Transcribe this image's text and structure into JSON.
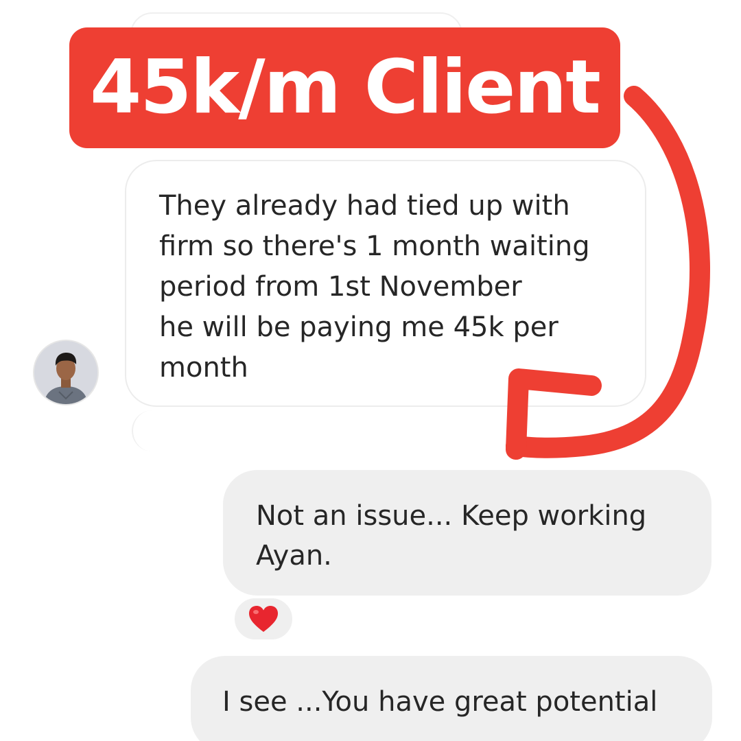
{
  "banner": {
    "text": "45k/m Client",
    "background_color": "#ee3f33",
    "text_color": "#ffffff"
  },
  "conversation": {
    "incoming_message": {
      "text": "They already had tied up with\nfirm so there's 1 month waiting\nperiod from 1st November\nhe will be paying me 45k per\nmonth",
      "avatar_icon": "user-avatar-photo"
    },
    "outgoing_messages": [
      {
        "text": "Not an issue... Keep working\nAyan.",
        "reaction": "❤️",
        "reaction_icon": "heart-icon"
      },
      {
        "text": "I see ...You have great potential"
      }
    ]
  },
  "annotation": {
    "arrow_icon": "curved-arrow-icon",
    "arrow_color": "#ee3f33"
  },
  "colors": {
    "incoming_bubble_border": "#ececec",
    "outgoing_bubble_bg": "#efefef",
    "message_text": "#262626"
  }
}
